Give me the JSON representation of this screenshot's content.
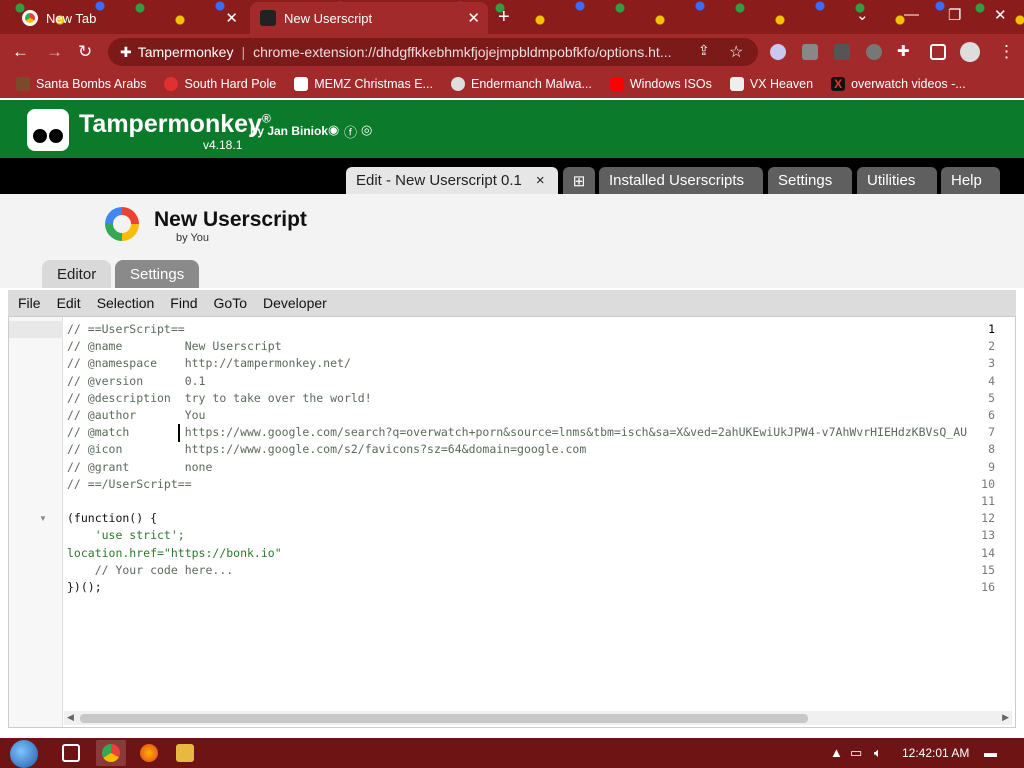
{
  "browser": {
    "tabs": [
      {
        "label": "New Tab",
        "icon": "chrome-icon"
      },
      {
        "label": "New Userscript",
        "icon": "tampermonkey-icon"
      }
    ],
    "omnibox": {
      "extension_label": "Tampermonkey",
      "url": "chrome-extension://dhdgffkkebhmkfjojejmpbldmpobfkfo/options.ht..."
    },
    "bookmarks": [
      {
        "label": "Santa Bombs Arabs",
        "color": "#7a4a2a"
      },
      {
        "label": "South Hard Pole",
        "color": "#e03030"
      },
      {
        "label": "MEMZ Christmas E...",
        "color": "#ffffff"
      },
      {
        "label": "Endermanch Malwa...",
        "color": "#dddddd"
      },
      {
        "label": "Windows ISOs",
        "color": "#ff0000"
      },
      {
        "label": "VX Heaven",
        "color": "#eeeeee"
      },
      {
        "label": "overwatch videos -...",
        "color": "#111111"
      }
    ]
  },
  "tampermonkey": {
    "title": "Tampermonkey",
    "registered": "®",
    "by": "by Jan Biniok",
    "version": "v4.18.1",
    "nav_tabs": [
      {
        "label": "Edit - New Userscript 0.1",
        "close": "×"
      },
      {
        "label": "⊞"
      },
      {
        "label": "Installed Userscripts"
      },
      {
        "label": "Settings"
      },
      {
        "label": "Utilities"
      },
      {
        "label": "Help"
      }
    ]
  },
  "script": {
    "name": "New Userscript",
    "author_line": "by You",
    "subtabs": [
      "Editor",
      "Settings"
    ]
  },
  "editor": {
    "menu": [
      "File",
      "Edit",
      "Selection",
      "Find",
      "GoTo",
      "Developer"
    ],
    "lines": [
      "// ==UserScript==",
      "// @name         New Userscript",
      "// @namespace    http://tampermonkey.net/",
      "// @version      0.1",
      "// @description  try to take over the world!",
      "// @author       You",
      "// @match        https://www.google.com/search?q=overwatch+porn&source=lnms&tbm=isch&sa=X&ved=2ahUKEwiUkJPW4-v7AhWvrHIEHdzKBVsQ_AU",
      "// @icon         https://www.google.com/s2/favicons?sz=64&domain=google.com",
      "// @grant        none",
      "// ==/UserScript==",
      "",
      "(function() {",
      "    'use strict';",
      "location.href=\"https://bonk.io\"",
      "    // Your code here...",
      "})();"
    ]
  },
  "taskbar": {
    "clock": "12:42:01 AM"
  }
}
